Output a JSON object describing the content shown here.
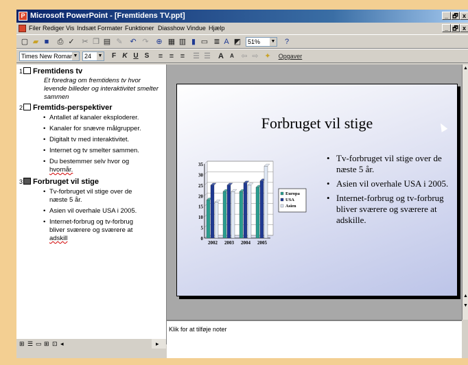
{
  "window": {
    "title": "Microsoft PowerPoint - [Fremtidens TV.ppt]",
    "controls": [
      "_",
      "🗗",
      "x"
    ]
  },
  "menu": [
    "Filer",
    "Rediger",
    "Vis",
    "Indsæt",
    "Formater",
    "Funktioner",
    "Diasshow",
    "Vindue",
    "Hjælp"
  ],
  "toolbar": {
    "zoom": "51%",
    "font_name": "Times New Roman",
    "font_size": "24",
    "bold": "F",
    "italic": "K",
    "underline": "U",
    "shadow": "S",
    "tasks": "Opgaver"
  },
  "outline": {
    "slides": [
      {
        "num": "1",
        "title": "Fremtidens tv",
        "subtitle": "Et foredrag om fremtidens tv hvor levende billeder og interaktivitet smelter sammen"
      },
      {
        "num": "2",
        "title": "Fremtids-perspektiver",
        "bullets": [
          "Antallet af kanaler eksploderer.",
          "Kanaler for snævre målgrupper.",
          "Digitalt tv med interaktivitet.",
          "Internet og tv smelter sammen.",
          "Du bestemmer selv hvor og",
          "hvornår."
        ]
      },
      {
        "num": "3",
        "title": "Forbruget vil stige",
        "bullets": [
          "Tv-forbruget vil stige over de",
          "næste 5 år.",
          "Asien vil overhale USA i 2005.",
          "Internet-forbrug og tv-forbrug",
          "bliver sværere og sværere at",
          "adskill"
        ]
      }
    ]
  },
  "slide": {
    "title": "Forbruget vil stige",
    "bullets": [
      "Tv-forbruget vil stige over de næste 5 år.",
      "Asien vil overhale USA i 2005.",
      "Internet-forbrug og tv-forbrug bliver sværere og sværere at adskille."
    ]
  },
  "notes": {
    "placeholder": "Klik for at tilføje noter"
  },
  "chart_data": {
    "type": "bar",
    "categories": [
      "2002",
      "2003",
      "2004",
      "2005"
    ],
    "series": [
      {
        "name": "Europa",
        "values": [
          18,
          22,
          22,
          24
        ]
      },
      {
        "name": "USA",
        "values": [
          25,
          25,
          26,
          27
        ]
      },
      {
        "name": "Asien",
        "values": [
          17,
          22,
          25,
          34
        ]
      }
    ],
    "ylim": [
      0,
      35
    ],
    "yticks": [
      "0",
      "5",
      "10",
      "15",
      "20",
      "25",
      "30",
      "35"
    ],
    "colors": [
      "#2a9d8f",
      "#1f3a93",
      "#dfe8f5"
    ],
    "grid": true,
    "legend": "right"
  }
}
